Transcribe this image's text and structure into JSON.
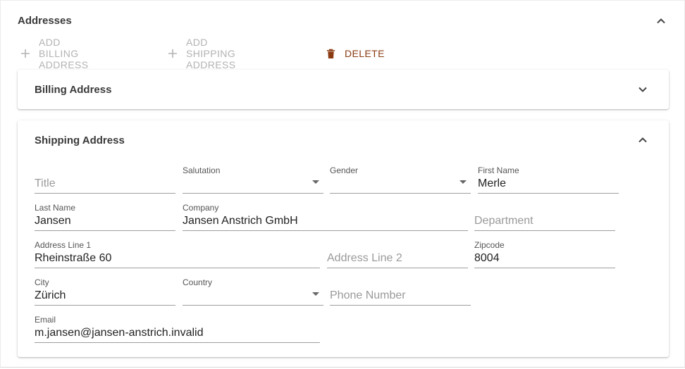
{
  "section": {
    "title": "Addresses"
  },
  "toolbar": {
    "add_billing": "Add Billing Address",
    "add_shipping": "Add Shipping Address",
    "delete": "Delete"
  },
  "billing": {
    "title": "Billing Address"
  },
  "shipping": {
    "title": "Shipping Address",
    "fields": {
      "title": {
        "label": "",
        "value": "",
        "placeholder": "Title"
      },
      "salutation": {
        "label": "Salutation",
        "value": ""
      },
      "gender": {
        "label": "Gender",
        "value": ""
      },
      "first_name": {
        "label": "First Name",
        "value": "Merle"
      },
      "last_name": {
        "label": "Last Name",
        "value": "Jansen"
      },
      "company": {
        "label": "Company",
        "value": "Jansen Anstrich GmbH"
      },
      "department": {
        "label": "",
        "value": "",
        "placeholder": "Department"
      },
      "address_line_1": {
        "label": "Address Line 1",
        "value": "Rheinstraße 60"
      },
      "address_line_2": {
        "label": "",
        "value": "",
        "placeholder": "Address Line 2"
      },
      "zipcode": {
        "label": "Zipcode",
        "value": "8004"
      },
      "city": {
        "label": "City",
        "value": "Zürich"
      },
      "country": {
        "label": "Country",
        "value": ""
      },
      "phone": {
        "label": "",
        "value": "",
        "placeholder": "Phone Number"
      },
      "email": {
        "label": "Email",
        "value": "m.jansen@jansen-anstrich.invalid"
      }
    }
  },
  "colors": {
    "danger": "#8a3b12",
    "disabled": "#b3b3b3",
    "underline": "#9e9e9e"
  },
  "icons": {
    "collapse": "chevron-up-icon",
    "expand": "chevron-down-icon",
    "add": "plus-icon",
    "delete": "trash-icon",
    "select": "caret-down-icon"
  }
}
